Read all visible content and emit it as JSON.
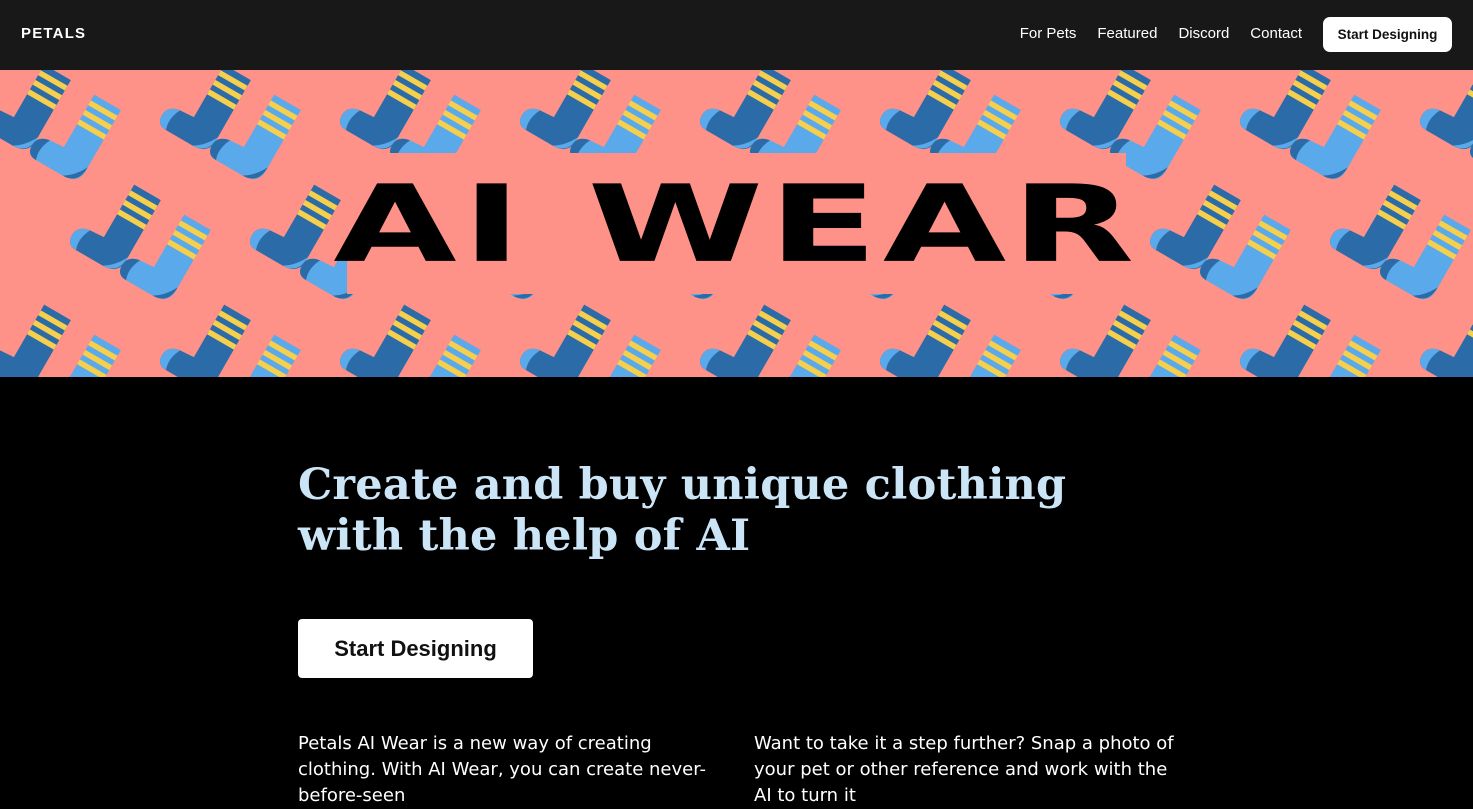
{
  "nav": {
    "brand": "PETALS",
    "links": [
      {
        "label": "For Pets"
      },
      {
        "label": "Featured"
      },
      {
        "label": "Discord"
      },
      {
        "label": "Contact"
      }
    ],
    "cta_label": "Start Designing"
  },
  "hero": {
    "logo_text": "AI WEAR",
    "pattern_icon": "sock-icon",
    "colors": {
      "background": "#fe9188",
      "sock_dark": "#2a6ba8",
      "sock_light": "#5aa9ea",
      "stripe": "#f6d04d"
    }
  },
  "main": {
    "headline": "Create and buy unique clothing with the help of AI",
    "cta_label": "Start Designing",
    "paragraph_1": "Petals AI Wear is a new way of creating clothing. With AI Wear, you can create never-before-seen",
    "paragraph_2": "Want to take it a step further? Snap a photo of your pet or other reference and work with the AI to turn it"
  }
}
